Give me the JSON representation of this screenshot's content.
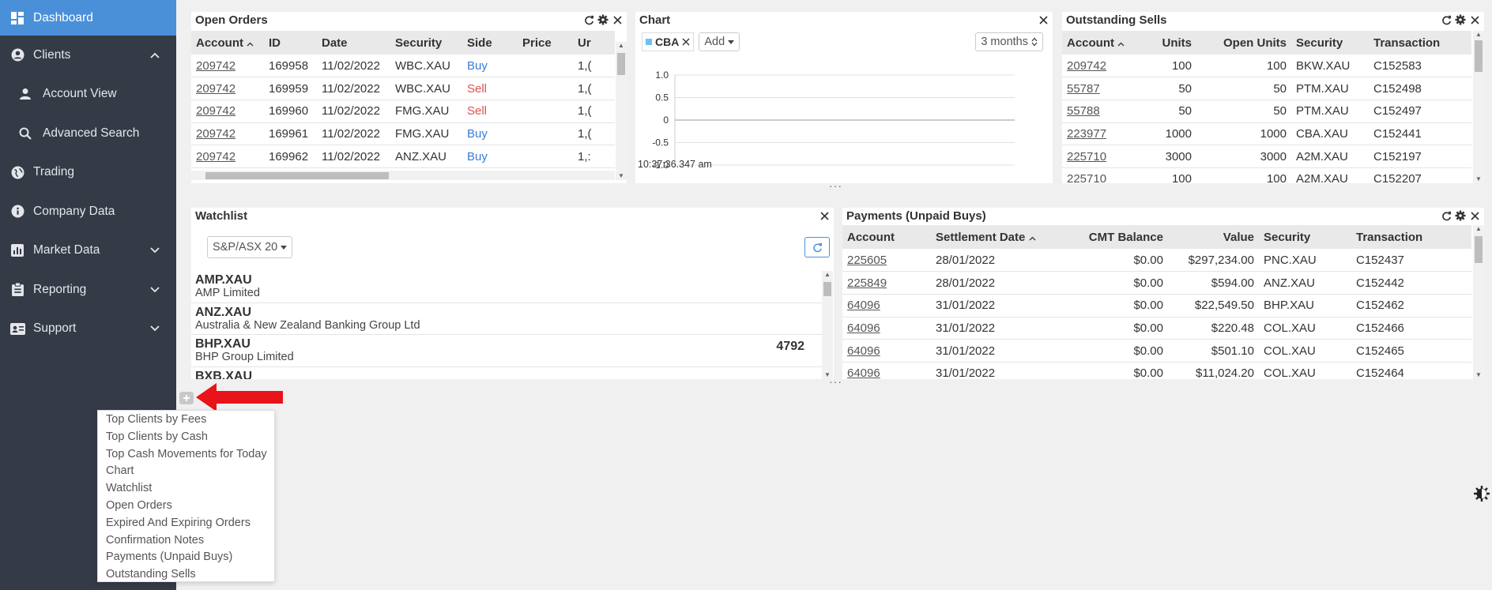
{
  "sidebar": {
    "items": [
      {
        "label": "Dashboard",
        "icon": "dashboard-icon",
        "active": true
      },
      {
        "label": "Clients",
        "icon": "user-circle-icon",
        "chevron": "up"
      },
      {
        "label": "Account View",
        "icon": "person-icon",
        "sub": true
      },
      {
        "label": "Advanced Search",
        "icon": "search-icon",
        "sub": true
      },
      {
        "label": "Trading",
        "icon": "globe-icon"
      },
      {
        "label": "Company Data",
        "icon": "info-icon"
      },
      {
        "label": "Market Data",
        "icon": "bar-chart-icon",
        "chevron": "down"
      },
      {
        "label": "Reporting",
        "icon": "clipboard-icon",
        "chevron": "down"
      },
      {
        "label": "Support",
        "icon": "id-card-icon",
        "chevron": "down"
      }
    ]
  },
  "open_orders": {
    "title": "Open Orders",
    "columns": [
      "Account",
      "ID",
      "Date",
      "Security",
      "Side",
      "Price",
      "Ur"
    ],
    "rows": [
      {
        "account": "209742",
        "id": "169958",
        "date": "11/02/2022",
        "security": "WBC.XAU",
        "side": "Buy",
        "price": "",
        "units": "1,("
      },
      {
        "account": "209742",
        "id": "169959",
        "date": "11/02/2022",
        "security": "WBC.XAU",
        "side": "Sell",
        "price": "",
        "units": "1,("
      },
      {
        "account": "209742",
        "id": "169960",
        "date": "11/02/2022",
        "security": "FMG.XAU",
        "side": "Sell",
        "price": "",
        "units": "1,("
      },
      {
        "account": "209742",
        "id": "169961",
        "date": "11/02/2022",
        "security": "FMG.XAU",
        "side": "Buy",
        "price": "",
        "units": "1,("
      },
      {
        "account": "209742",
        "id": "169962",
        "date": "11/02/2022",
        "security": "ANZ.XAU",
        "side": "Buy",
        "price": "",
        "units": "1,:"
      }
    ]
  },
  "chart_panel": {
    "title": "Chart",
    "symbol": "CBA",
    "add_label": "Add",
    "period": "3 months",
    "timestamp": "10:37:36.347 am"
  },
  "chart_data": {
    "type": "line",
    "x": [],
    "series": [],
    "ylim": [
      -1.0,
      1.0
    ],
    "yticks": [
      "1.0",
      "0.5",
      "0",
      "-0.5",
      "-1.0"
    ],
    "grid": true
  },
  "outstanding_sells": {
    "title": "Outstanding Sells",
    "columns": [
      "Account",
      "Units",
      "Open Units",
      "Security",
      "Transaction"
    ],
    "rows": [
      {
        "account": "209742",
        "units": "100",
        "open_units": "100",
        "security": "BKW.XAU",
        "transaction": "C152583"
      },
      {
        "account": "55787",
        "units": "50",
        "open_units": "50",
        "security": "PTM.XAU",
        "transaction": "C152498"
      },
      {
        "account": "55788",
        "units": "50",
        "open_units": "50",
        "security": "PTM.XAU",
        "transaction": "C152497"
      },
      {
        "account": "223977",
        "units": "1000",
        "open_units": "1000",
        "security": "CBA.XAU",
        "transaction": "C152441"
      },
      {
        "account": "225710",
        "units": "3000",
        "open_units": "3000",
        "security": "A2M.XAU",
        "transaction": "C152197"
      },
      {
        "account": "225710",
        "units": "100",
        "open_units": "100",
        "security": "A2M.XAU",
        "transaction": "C152207"
      }
    ]
  },
  "watchlist": {
    "title": "Watchlist",
    "index_select": "S&P/ASX 20",
    "items": [
      {
        "code": "AMP.XAU",
        "name": "AMP Limited",
        "value": ""
      },
      {
        "code": "ANZ.XAU",
        "name": "Australia & New Zealand Banking Group Ltd",
        "value": ""
      },
      {
        "code": "BHP.XAU",
        "name": "BHP Group Limited",
        "value": "4792"
      },
      {
        "code": "BXB.XAU",
        "name": "",
        "value": ""
      }
    ]
  },
  "payments": {
    "title": "Payments (Unpaid Buys)",
    "columns": [
      "Account",
      "Settlement Date",
      "CMT Balance",
      "Value",
      "Security",
      "Transaction"
    ],
    "rows": [
      {
        "account": "225605",
        "date": "28/01/2022",
        "cmt": "$0.00",
        "value": "$297,234.00",
        "security": "PNC.XAU",
        "transaction": "C152437"
      },
      {
        "account": "225849",
        "date": "28/01/2022",
        "cmt": "$0.00",
        "value": "$594.00",
        "security": "ANZ.XAU",
        "transaction": "C152442"
      },
      {
        "account": "64096",
        "date": "31/01/2022",
        "cmt": "$0.00",
        "value": "$22,549.50",
        "security": "BHP.XAU",
        "transaction": "C152462"
      },
      {
        "account": "64096",
        "date": "31/01/2022",
        "cmt": "$0.00",
        "value": "$220.48",
        "security": "COL.XAU",
        "transaction": "C152466"
      },
      {
        "account": "64096",
        "date": "31/01/2022",
        "cmt": "$0.00",
        "value": "$501.10",
        "security": "COL.XAU",
        "transaction": "C152465"
      },
      {
        "account": "64096",
        "date": "31/01/2022",
        "cmt": "$0.00",
        "value": "$11,024.20",
        "security": "COL.XAU",
        "transaction": "C152464"
      }
    ]
  },
  "add_widget_menu": {
    "items": [
      "Top Clients by Fees",
      "Top Clients by Cash",
      "Top Cash Movements for Today",
      "Chart",
      "Watchlist",
      "Open Orders",
      "Expired And Expiring Orders",
      "Confirmation Notes",
      "Payments (Unpaid Buys)",
      "Outstanding Sells"
    ]
  },
  "colors": {
    "sidebar_bg": "#353a47",
    "active_bg": "#4a90d9",
    "buy": "#3a7bd5",
    "sell": "#d9534f",
    "annotation_arrow": "#e8141a"
  }
}
